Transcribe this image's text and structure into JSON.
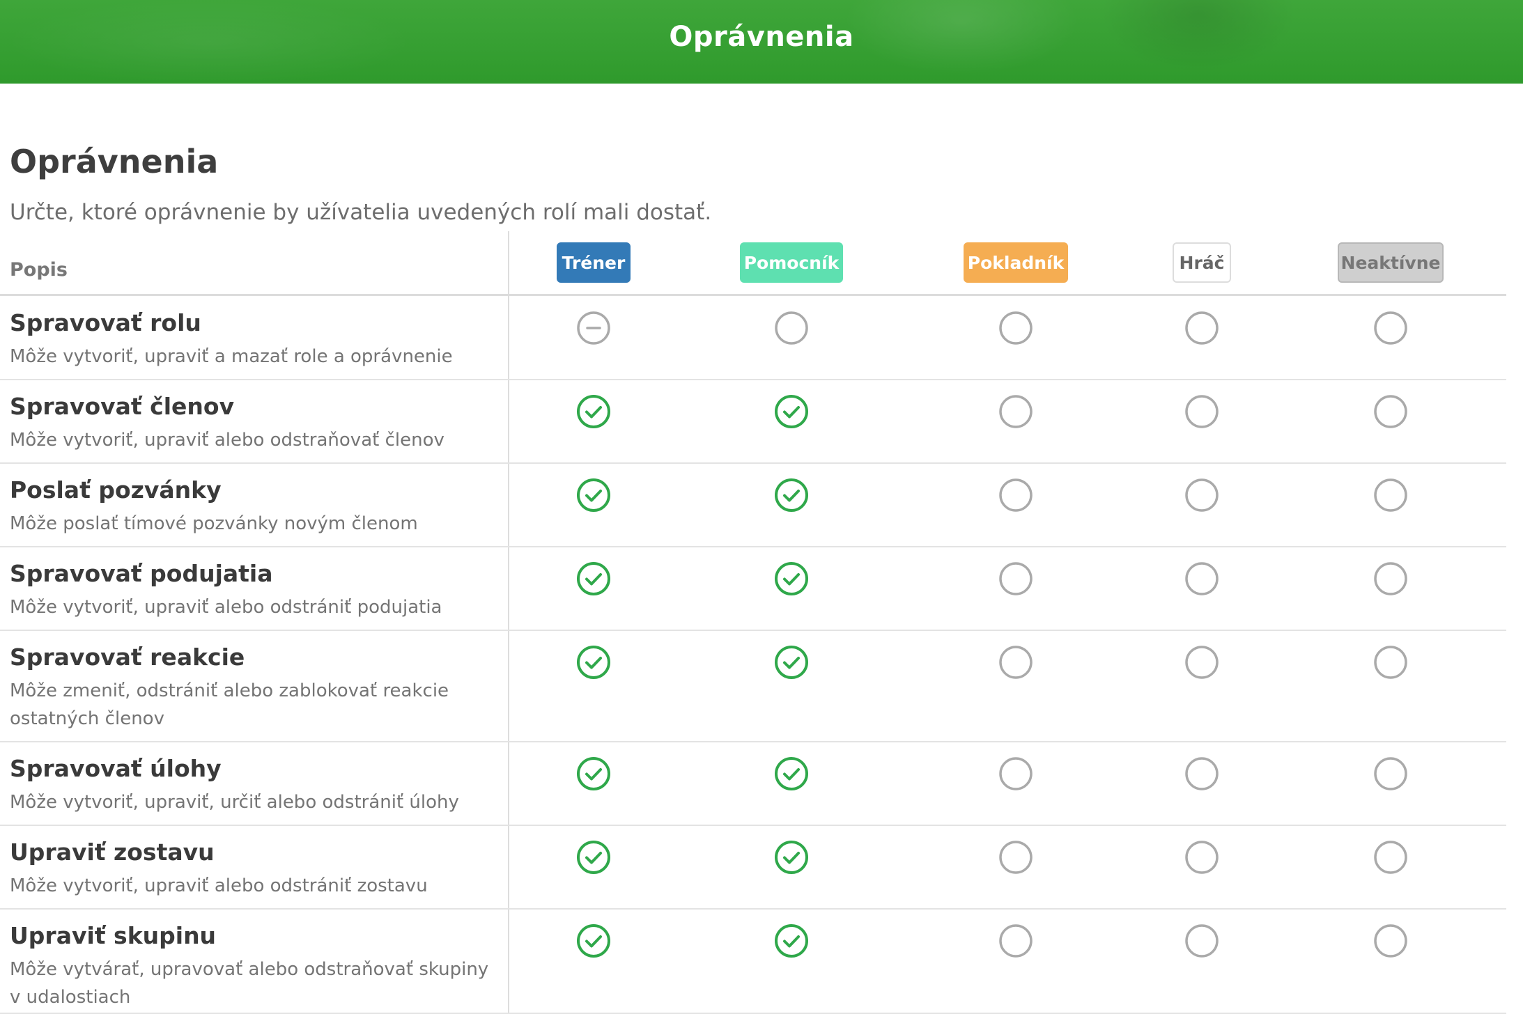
{
  "header": {
    "title": "Oprávnenia"
  },
  "page": {
    "title": "Oprávnenia",
    "subtitle": "Určte, ktoré oprávnenie by užívatelia uvedených rolí mali dostať."
  },
  "table": {
    "description_header": "Popis",
    "roles": [
      {
        "label": "Tréner",
        "bg": "#337ab7",
        "fg": "#ffffff",
        "border": "#337ab7"
      },
      {
        "label": "Pomocník",
        "bg": "#5ee0b0",
        "fg": "#ffffff",
        "border": "#5ee0b0"
      },
      {
        "label": "Pokladník",
        "bg": "#f5ad52",
        "fg": "#ffffff",
        "border": "#f5ad52"
      },
      {
        "label": "Hráč",
        "bg": "#ffffff",
        "fg": "#666666",
        "border": "#dddddd"
      },
      {
        "label": "Neaktívne",
        "bg": "#cfcfcf",
        "fg": "#777777",
        "border": "#b8b8b8"
      }
    ],
    "rows": [
      {
        "title": "Spravovať rolu",
        "desc": "Môže vytvoriť, upraviť a mazať role a oprávnenie",
        "states": [
          "indeterminate",
          "unchecked",
          "unchecked",
          "unchecked",
          "unchecked"
        ]
      },
      {
        "title": "Spravovať členov",
        "desc": "Môže vytvoriť, upraviť alebo odstraňovať členov",
        "states": [
          "checked",
          "checked",
          "unchecked",
          "unchecked",
          "unchecked"
        ]
      },
      {
        "title": "Poslať pozvánky",
        "desc": "Môže poslať tímové pozvánky novým členom",
        "states": [
          "checked",
          "checked",
          "unchecked",
          "unchecked",
          "unchecked"
        ]
      },
      {
        "title": "Spravovať podujatia",
        "desc": "Môže vytvoriť, upraviť alebo odstrániť podujatia",
        "states": [
          "checked",
          "checked",
          "unchecked",
          "unchecked",
          "unchecked"
        ]
      },
      {
        "title": "Spravovať reakcie",
        "desc": "Môže zmeniť, odstrániť alebo zablokovať reakcie ostatných členov",
        "states": [
          "checked",
          "checked",
          "unchecked",
          "unchecked",
          "unchecked"
        ]
      },
      {
        "title": "Spravovať úlohy",
        "desc": "Môže vytvoriť, upraviť, určiť alebo odstrániť úlohy",
        "states": [
          "checked",
          "checked",
          "unchecked",
          "unchecked",
          "unchecked"
        ]
      },
      {
        "title": "Upraviť zostavu",
        "desc": "Môže vytvoriť, upraviť alebo odstrániť zostavu",
        "states": [
          "checked",
          "checked",
          "unchecked",
          "unchecked",
          "unchecked"
        ]
      },
      {
        "title": "Upraviť skupinu",
        "desc": "Môže vytvárať, upravovať alebo odstraňovať skupiny v udalostiach",
        "states": [
          "checked",
          "checked",
          "unchecked",
          "unchecked",
          "unchecked"
        ]
      }
    ]
  },
  "colors": {
    "checked": "#2fa84a",
    "unchecked": "#aaaaaa",
    "indeterminate": "#aaaaaa"
  },
  "icons": {
    "checked": "check-circle-icon",
    "unchecked": "empty-circle-icon",
    "indeterminate": "minus-circle-icon"
  }
}
